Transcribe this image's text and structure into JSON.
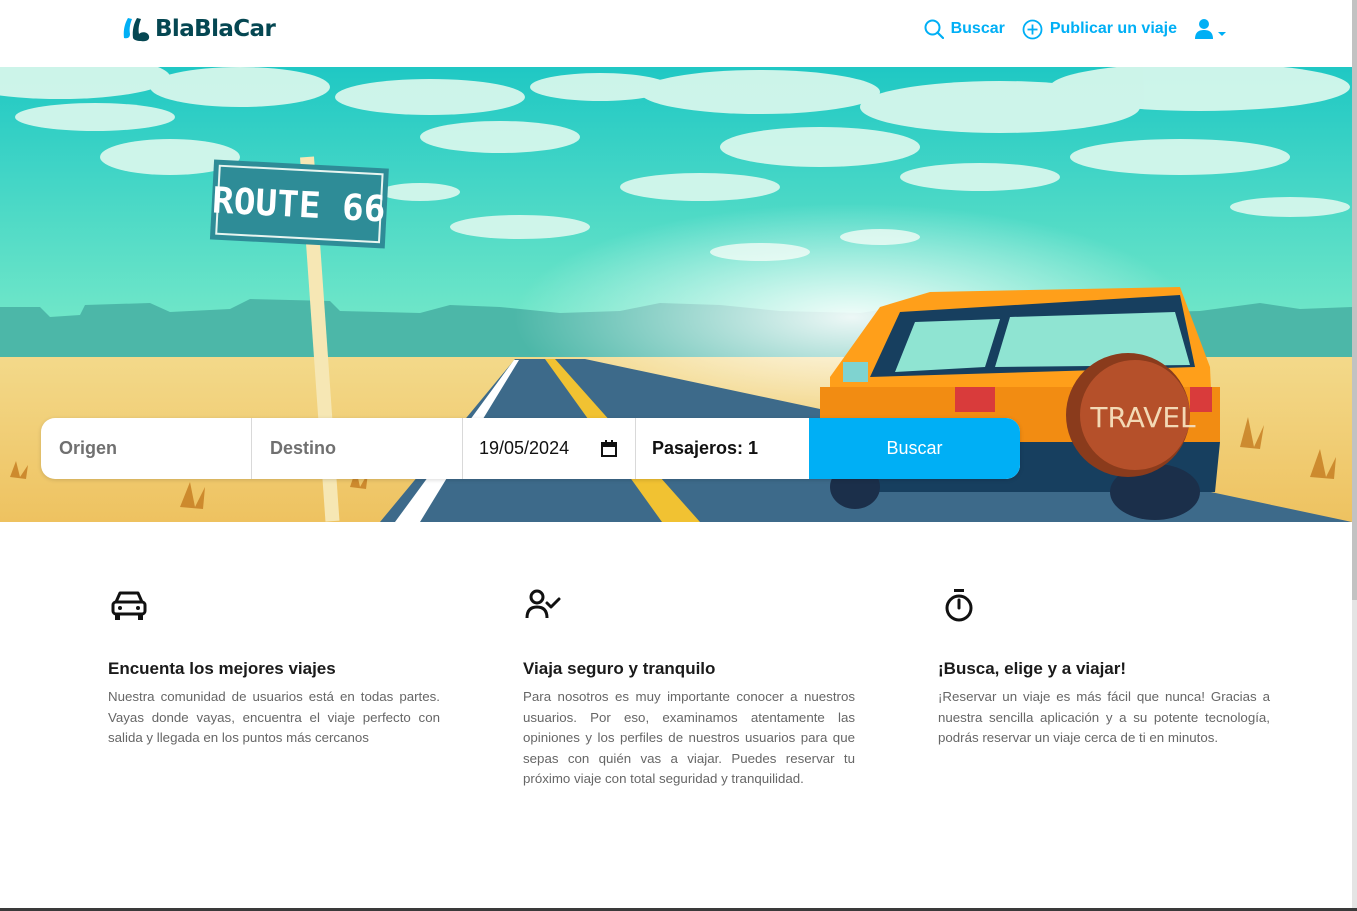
{
  "header": {
    "logo_text": "BlaBlaCar",
    "nav": {
      "search_label": "Buscar",
      "publish_label": "Publicar un viaje"
    }
  },
  "hero": {
    "sign_text": "ROUTE 66",
    "tire_text": "TRAVEL"
  },
  "search": {
    "origin_placeholder": "Origen",
    "destination_placeholder": "Destino",
    "date_value": "19/05/2024",
    "passengers_label": "Pasajeros: 1",
    "button_label": "Buscar"
  },
  "features": [
    {
      "icon": "car-icon",
      "title": "Encuenta los mejores viajes",
      "text": "Nuestra comunidad de usuarios está en todas partes. Vayas donde vayas, encuentra el viaje perfecto con salida y llegada en los puntos más cercanos"
    },
    {
      "icon": "user-check-icon",
      "title": "Viaja seguro y tranquilo",
      "text": "Para nosotros es muy importante conocer a nuestros usuarios. Por eso, examinamos atentamente las opiniones y los perfiles de nuestros usuarios para que sepas con quién vas a viajar. Puedes reservar tu próximo viaje con total seguridad y tranquilidad."
    },
    {
      "icon": "stopwatch-icon",
      "title": "¡Busca, elige y a viajar!",
      "text": "¡Reservar un viaje es más fácil que nunca! Gracias a nuestra sencilla aplicación y a su potente tecnología, podrás reservar un viaje cerca de ti en minutos."
    }
  ],
  "colors": {
    "accent": "#00aff5",
    "brand_dark": "#054752"
  }
}
